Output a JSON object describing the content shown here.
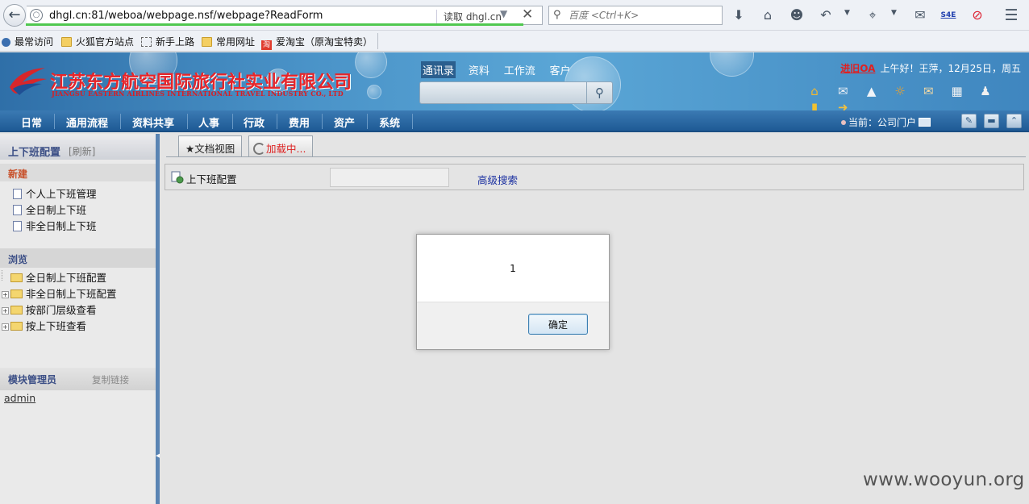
{
  "browser": {
    "url": "dhgl.cn:81/weboa/webpage.nsf/webpage?ReadForm",
    "reader_label": "读取 dhgl.cn",
    "search_placeholder": "百度 <Ctrl+K>",
    "bookmarks": [
      "最常访问",
      "火狐官方站点",
      "新手上路",
      "常用网址",
      "爱淘宝（原淘宝特卖）"
    ],
    "toolbar_icons": [
      "download-icon",
      "home-icon",
      "chat-face-icon",
      "undo-icon",
      "crop-icon",
      "speech-bubble-icon",
      "s4e-icon",
      "no-entry-icon",
      "menu-icon"
    ],
    "s4e_label": "S4E"
  },
  "header": {
    "company_cn": "江苏东方航空国际旅行社实业有限公司",
    "company_en": "JIANGSU EASTERN AIRLINES INTERNATIONAL TRAVEL INDUSTRY CO., LTD",
    "top_tabs": [
      "通讯录",
      "资料",
      "工作流",
      "客户"
    ],
    "oa_link": "进旧OA",
    "greeting": "上午好！王萍，12月25日，周五"
  },
  "nav": {
    "items": [
      "日常",
      "通用流程",
      "资料共享",
      "人事",
      "行政",
      "费用",
      "资产",
      "系统"
    ],
    "current_label": "当前：公司门户"
  },
  "sidebar": {
    "title": "上下班配置",
    "refresh": "[刷新]",
    "new_section": "新建",
    "new_items": [
      "个人上下班管理",
      "全日制上下班",
      "非全日制上下班"
    ],
    "browse_section": "浏览",
    "browse_items": [
      "全日制上下班配置",
      "非全日制上下班配置",
      "按部门层级查看",
      "按上下班查看"
    ],
    "admin_title": "模块管理员",
    "copy_link": "复制链接",
    "admin_user": "admin"
  },
  "main": {
    "tab_doc_view": "★文档视图",
    "tab_loading": "加载中...",
    "form_title": "上下班配置",
    "advanced_search": "高级搜索"
  },
  "dialog": {
    "message": "1",
    "ok_label": "确定"
  },
  "watermark": "www.wooyun.org",
  "colors": {
    "nav_blue": "#1e5a95",
    "company_red": "#e6252a",
    "loading_red": "#dd2222",
    "link_blue": "#1a2fa0"
  }
}
